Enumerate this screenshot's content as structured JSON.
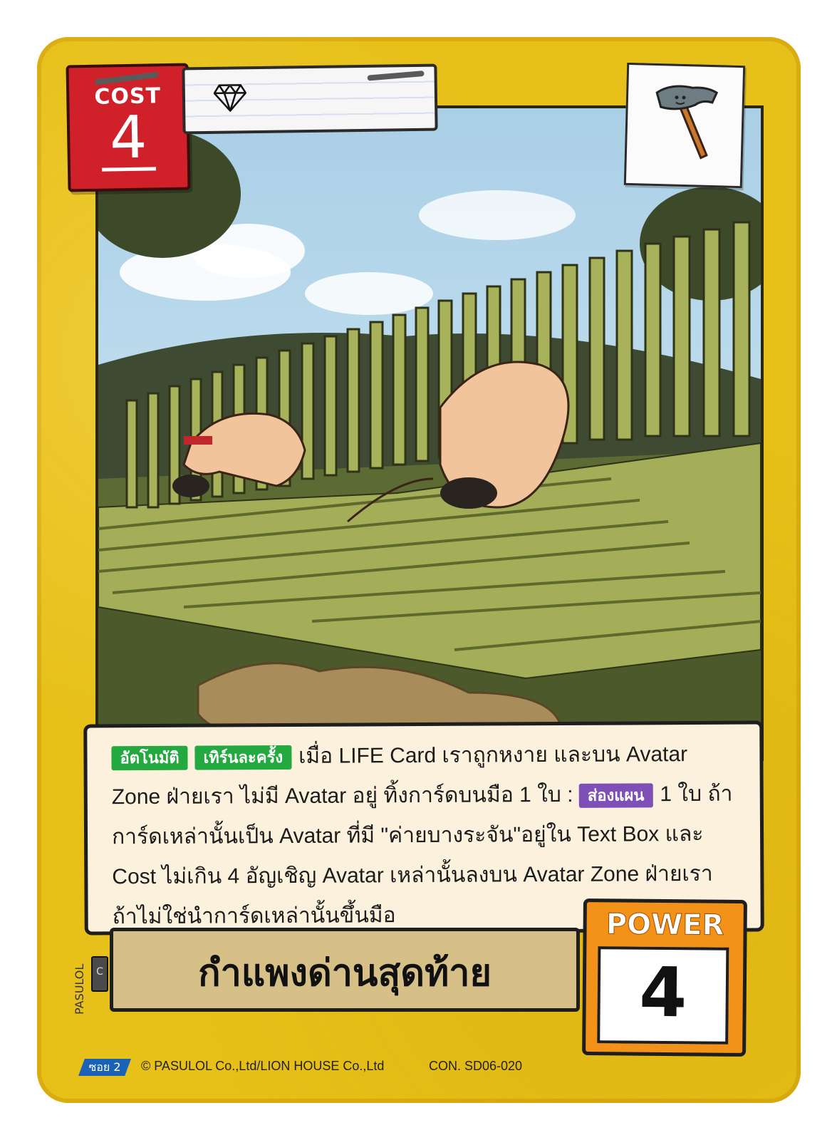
{
  "card": {
    "cost_label": "COST",
    "cost_value": "4",
    "power_label": "POWER",
    "power_value": "4",
    "name": "กำแพงด่านสุดท้าย",
    "gem_icon": "diamond-icon",
    "type_icon": "hammer-icon",
    "ability": {
      "tag1": "อัตโนมัติ",
      "tag2": "เทิร์นละครั้ง",
      "text1": "เมื่อ LIFE Card เราถูกหงาย และบน Avatar Zone ฝ่ายเรา ไม่มี Avatar อยู่ ทิ้งการ์ดบนมือ 1 ใบ :",
      "tag3": "ส่องแผน",
      "text2": "1 ใบ ถ้าการ์ดเหล่านั้นเป็น Avatar ที่มี \"ค่ายบางระจัน\"อยู่ใน Text Box และ Cost ไม่เกิน 4 อัญเชิญ Avatar เหล่านั้นลงบน Avatar Zone ฝ่ายเรา ถ้าไม่ใช่นำการ์ดเหล่านั้นขึ้นมือ"
    },
    "rarity": "C",
    "artist": "PASULOL",
    "set_badge": "ซอย 2",
    "copyright": "© PASULOL Co.,Ltd/LION HOUSE Co.,Ltd",
    "card_code": "CON. SD06-020",
    "colors": {
      "frame": "#e7c019",
      "cost": "#d0202a",
      "power": "#f39218",
      "tag_green": "#24a840",
      "tag_purple": "#7d4fb7",
      "set_badge": "#1a62b8"
    }
  }
}
